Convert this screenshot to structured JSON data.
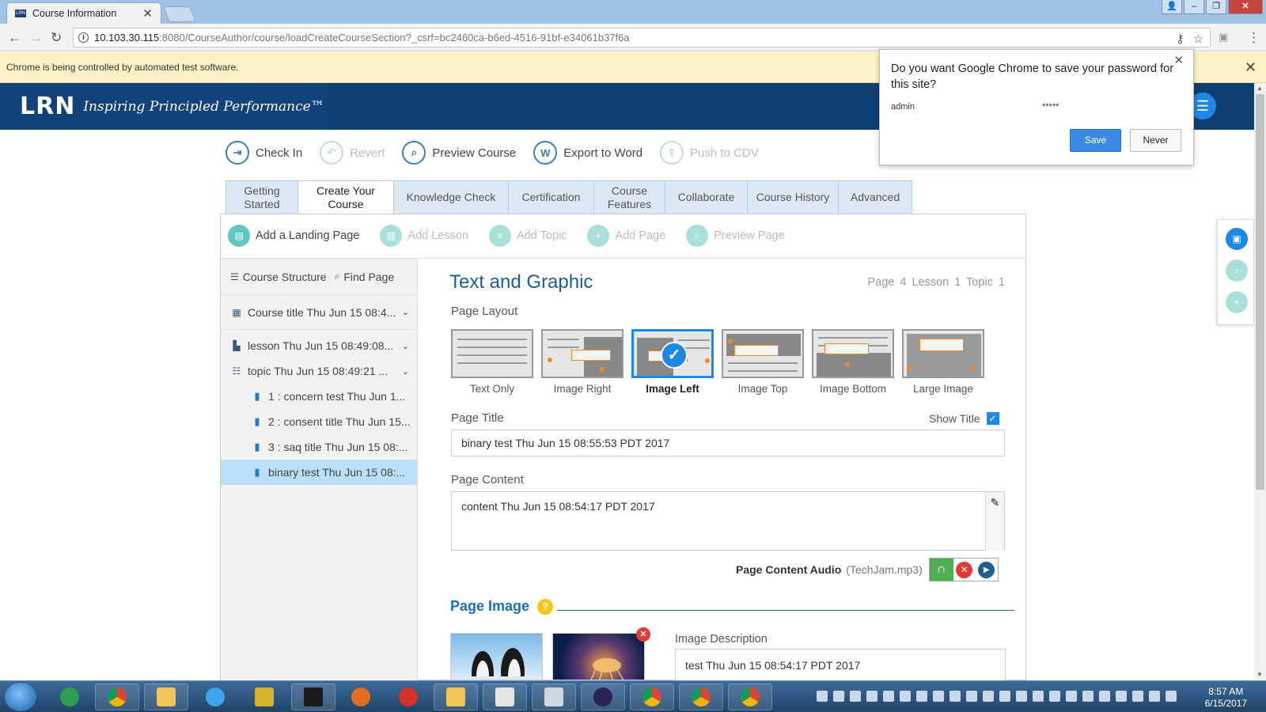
{
  "browser": {
    "tab_title": "Course Information",
    "url_host": "10.103.30.115",
    "url_rest": ":8080/CourseAuthor/course/loadCreateCourseSection?_csrf=bc2460ca-b6ed-4516-91bf-e34061b37f6a",
    "infobar_text": "Chrome is being controlled by automated test software."
  },
  "password_prompt": {
    "question": "Do you want Google Chrome to save your password for this site?",
    "username": "admin",
    "password": "*****",
    "save_label": "Save",
    "never_label": "Never"
  },
  "header": {
    "logo": "LRN",
    "tagline": "Inspiring Principled Performance™"
  },
  "toolbar": [
    {
      "label": "Check In",
      "icon": "check-in-icon",
      "enabled": true
    },
    {
      "label": "Revert",
      "icon": "revert-icon",
      "enabled": false
    },
    {
      "label": "Preview Course",
      "icon": "preview-icon",
      "enabled": true
    },
    {
      "label": "Export to Word",
      "icon": "word-icon",
      "enabled": true
    },
    {
      "label": "Push to CDV",
      "icon": "push-icon",
      "enabled": false
    }
  ],
  "tabs": [
    {
      "label": "Getting Started"
    },
    {
      "label": "Create Your Course",
      "active": true
    },
    {
      "label": "Knowledge Check"
    },
    {
      "label": "Certification"
    },
    {
      "label": "Course Features"
    },
    {
      "label": "Collaborate"
    },
    {
      "label": "Course History"
    },
    {
      "label": "Advanced"
    }
  ],
  "subtoolbar": [
    {
      "label": "Add a Landing Page",
      "enabled": true
    },
    {
      "label": "Add Lesson",
      "enabled": false
    },
    {
      "label": "Add Topic",
      "enabled": false
    },
    {
      "label": "Add Page",
      "enabled": false
    },
    {
      "label": "Preview Page",
      "enabled": false
    }
  ],
  "sidebar": {
    "course_structure_label": "Course Structure",
    "find_page_label": "Find Page",
    "course": "Course title Thu Jun 15 08:4...",
    "lesson": "lesson Thu Jun 15 08:49:08...",
    "topic": "topic Thu Jun 15 08:49:21 ...",
    "pages": [
      {
        "label": "1 : concern test Thu Jun 1..."
      },
      {
        "label": "2 : consent title Thu Jun 15..."
      },
      {
        "label": "3 : saq title Thu Jun 15 08:..."
      },
      {
        "label": "binary test Thu Jun 15 08:...",
        "selected": true
      }
    ]
  },
  "editor": {
    "title": "Text and Graphic",
    "breadcrumb": "Page 4  Lesson 1  Topic 1",
    "page_layout_label": "Page Layout",
    "layouts": [
      {
        "label": "Text Only"
      },
      {
        "label": "Image Right"
      },
      {
        "label": "Image Left",
        "selected": true
      },
      {
        "label": "Image Top"
      },
      {
        "label": "Image Bottom"
      },
      {
        "label": "Large Image"
      }
    ],
    "page_title_label": "Page Title",
    "show_title_label": "Show Title",
    "show_title_checked": true,
    "page_title_value": "binary test Thu Jun 15 08:55:53 PDT 2017",
    "page_content_label": "Page Content",
    "page_content_value": "content Thu Jun 15 08:54:17 PDT 2017",
    "audio_label": "Page Content Audio",
    "audio_file": "(TechJam.mp3)",
    "page_image_label": "Page Image",
    "image_description_label": "Image Description",
    "image_description_value": "test Thu Jun 15 08:54:17 PDT 2017"
  },
  "taskbar": {
    "time": "8:57 AM",
    "date": "6/15/2017"
  }
}
